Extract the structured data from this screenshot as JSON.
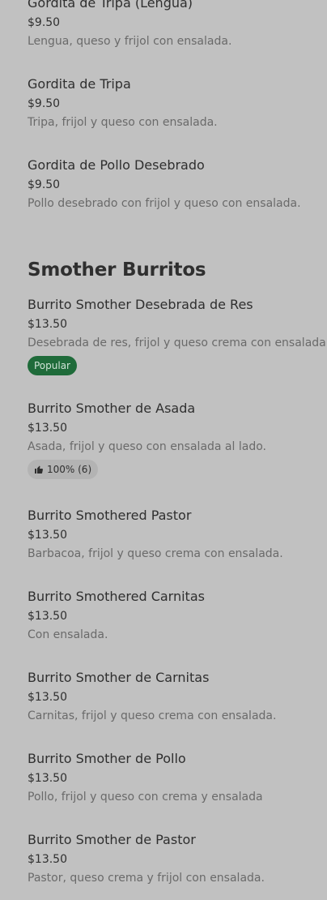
{
  "items": [
    {
      "name": "Gordita de Tripa (Lengua)",
      "price": "$9.50",
      "desc": "Lengua, queso y frijol con ensalada."
    },
    {
      "name": "Gordita de Tripa",
      "price": "$9.50",
      "desc": "Tripa, frijol y queso con ensalada."
    },
    {
      "name": "Gordita de Pollo Desebrado",
      "price": "$9.50",
      "desc": "Pollo desebrado con frijol y queso con ensalada."
    }
  ],
  "section": {
    "title": "Smother Burritos",
    "items": [
      {
        "name": "Burrito Smother Desebrada de Res",
        "price": "$13.50",
        "desc": "Desebrada de res, frijol y queso crema con ensalada.",
        "badge": "Popular"
      },
      {
        "name": "Burrito Smother de Asada",
        "price": "$13.50",
        "desc": "Asada, frijol y queso con ensalada al lado.",
        "rating": "100% (6)"
      },
      {
        "name": "Burrito Smothered Pastor",
        "price": "$13.50",
        "desc": "Barbacoa, frijol y queso crema con ensalada."
      },
      {
        "name": "Burrito Smothered Carnitas",
        "price": "$13.50",
        "desc": "Con ensalada."
      },
      {
        "name": "Burrito Smother de Carnitas",
        "price": "$13.50",
        "desc": "Carnitas, frijol y queso crema con ensalada."
      },
      {
        "name": "Burrito Smother de Pollo",
        "price": "$13.50",
        "desc": "Pollo, frijol y queso con crema y ensalada"
      },
      {
        "name": "Burrito Smother de Pastor",
        "price": "$13.50",
        "desc": "Pastor, queso crema y frijol con ensalada."
      }
    ]
  },
  "icons": {
    "thumbs_up": "thumbs-up-icon"
  },
  "colors": {
    "background": "#c1c1c1",
    "popular_badge": "#1f6b3a",
    "rating_badge": "#b3b3b3"
  }
}
